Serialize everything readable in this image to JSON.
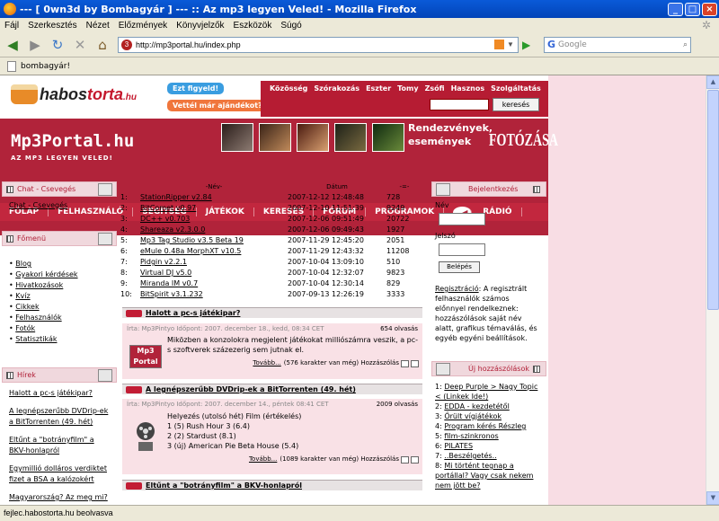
{
  "window": {
    "title": "--- [ 0wn3d by Bombagyár ] --- :: Az mp3 legyen Veled! - Mozilla Firefox"
  },
  "menu": [
    "Fájl",
    "Szerkesztés",
    "Nézet",
    "Előzmények",
    "Könyvjelzők",
    "Eszközök",
    "Súgó"
  ],
  "nav": {
    "url": "http://mp3portal.hu/index.php",
    "search_placeholder": "Google"
  },
  "bookmark": "bombagyár!",
  "status": "fejlec.habostorta.hu beolvasva",
  "top": {
    "logo_prefix": "habos",
    "logo_accent": "torta",
    "logo_suffix": ".hu",
    "ez_figyelo": "Ezt figyeld!",
    "ajandek": "Vettél már ajándékot?",
    "links": [
      "Közösség",
      "Szórakozás",
      "Eszter",
      "Tomy",
      "Zsófi",
      "Hasznos",
      "Szolgáltatás"
    ],
    "search_btn": "keresés"
  },
  "banner": {
    "brand": "Mp3Portal.hu",
    "slogan": "AZ MP3 LEGYEN VELED!",
    "promo_line1": "Rendezvények,",
    "promo_line2": "események",
    "fotozasa": "FOTÓZÁSA"
  },
  "mainnav": [
    "FŐLAP",
    "FELHASZNÁLÓ",
    "SEGÍTSÉG",
    "JÁTÉKOK",
    "KERESÉS",
    "FÓRUM",
    "PROGRAMOK",
    "RÁDIÓ"
  ],
  "left": {
    "chat_title": "Chat - Csevegés",
    "chat_link": "Chat - Csevegés",
    "menu_title": "Főmenü",
    "menu_items": [
      "Blog",
      "Gyakori kérdések",
      "Hivatkozások",
      "Kvíz",
      "Cikkek",
      "Felhasználók",
      "Fotók",
      "Statisztikák"
    ],
    "news_title": "Hírek",
    "news_items": [
      "Halott a pc-s játékipar?",
      "A legnépszerűbb DVDrip-ek a BitTorrenten (49. hét)",
      "Eltűnt a \"botrányfilm\" a BKV-honlapról",
      "Egymillió dolláros verdiktet fizet a BSA a kalózokért",
      "Magyarország? Az meg mi?"
    ]
  },
  "downloads": {
    "headers": [
      "-Név-",
      "Dátum",
      "-=-"
    ],
    "rows": [
      {
        "n": "1:",
        "name": "StationRipper v2.84",
        "date": "2007-12-12 12:48:48",
        "count": "728"
      },
      {
        "n": "2:",
        "name": "BitComet v0.97",
        "date": "2007-12-10 11:51:39",
        "count": "9249"
      },
      {
        "n": "3:",
        "name": "DC++ v0.703",
        "date": "2007-12-06 09:51:49",
        "count": "20722"
      },
      {
        "n": "4:",
        "name": "Shareaza v2.3.0.0",
        "date": "2007-12-06 09:49:43",
        "count": "1927"
      },
      {
        "n": "5:",
        "name": "Mp3 Tag Studio v3.5 Beta 19",
        "date": "2007-11-29 12:45:20",
        "count": "2051"
      },
      {
        "n": "6:",
        "name": "eMule 0.48a MorphXT v10.5",
        "date": "2007-11-29 12:43:32",
        "count": "11208"
      },
      {
        "n": "7:",
        "name": "Pidgin v2.2.1",
        "date": "2007-10-04 13:09:10",
        "count": "510"
      },
      {
        "n": "8:",
        "name": "Virtual DJ v5.0",
        "date": "2007-10-04 12:32:07",
        "count": "9823"
      },
      {
        "n": "9:",
        "name": "Miranda IM v0.7",
        "date": "2007-10-04 12:30:14",
        "count": "829"
      },
      {
        "n": "10:",
        "name": "BitSpirit v3.1.232",
        "date": "2007-09-13 12:26:19",
        "count": "3333"
      }
    ]
  },
  "news": [
    {
      "title": "Halott a pc-s játékipar?",
      "meta": "Írta: Mp3Pintyo Időpont: 2007. december 18., kedd, 08:34 CET",
      "reads": "654 olvasás",
      "logo": "Mp3 Portal",
      "text": "Miközben a konzolokra megjelent játékokat milliószámra veszik, a pc-s szoftverek százezerig sem jutnak el.",
      "more": "Tovább...",
      "extra": "(576 karakter van még) Hozzászólás"
    },
    {
      "title": "A legnépszerűbb DVDrip-ek a BitTorrenten (49. hét)",
      "meta": "Írta: Mp3Pintyo Időpont: 2007. december 14., péntek 08:41 CET",
      "reads": "2009 olvasás",
      "lines": [
        "Helyezés (utolsó hét) Film (értékelés)",
        "1 (5) Rush Hour 3 (6.4)",
        "2 (2) Stardust (8.1)",
        "3 (új) American Pie Beta House (5.4)"
      ],
      "more": "Tovább...",
      "extra": "(1089 karakter van még) Hozzászólás"
    },
    {
      "title": "Eltűnt a \"botrányfilm\" a BKV-honlapról"
    }
  ],
  "right": {
    "login_title": "Bejelentkezés",
    "name_label": "Név",
    "pass_label": "Jelszó",
    "login_btn": "Belépés",
    "reg_link": "Regisztráció",
    "reg_text": ": A regisztrált felhasználók számos előnnyel rendelkeznek: hozzászólások saját név alatt, grafikus témaválás, és egyéb egyéni beállítások.",
    "posts_title": "Új hozzászólások",
    "posts": [
      "Deep Purple > Nagy Topic < (Linkek Ide!)",
      "EDDA - kezdetétől",
      "Őrült vígjátékok",
      "Program kérés Részleg",
      "film-szinkronos",
      "PILATES",
      "..Beszélgetés..",
      "Mi történt tegnap a portállal? Vagy csak nekem nem jött be?"
    ]
  }
}
